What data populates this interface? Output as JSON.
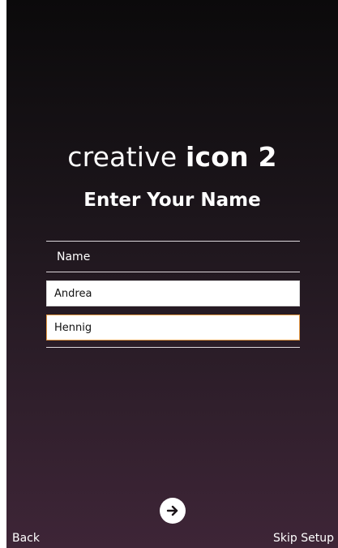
{
  "header": {
    "brand_light": "creative",
    "brand_bold": "icon 2",
    "heading": "Enter Your Name"
  },
  "form": {
    "section_label": "Name",
    "first_name_value": "Andrea",
    "last_name_value": "Hennig"
  },
  "footer": {
    "back_label": "Back",
    "skip_label": "Skip Setup",
    "next_icon": "arrow-right-icon"
  },
  "colors": {
    "background_top": "#0b0a0b",
    "background_bottom": "#3e2537",
    "focus_border": "#e89a45"
  }
}
